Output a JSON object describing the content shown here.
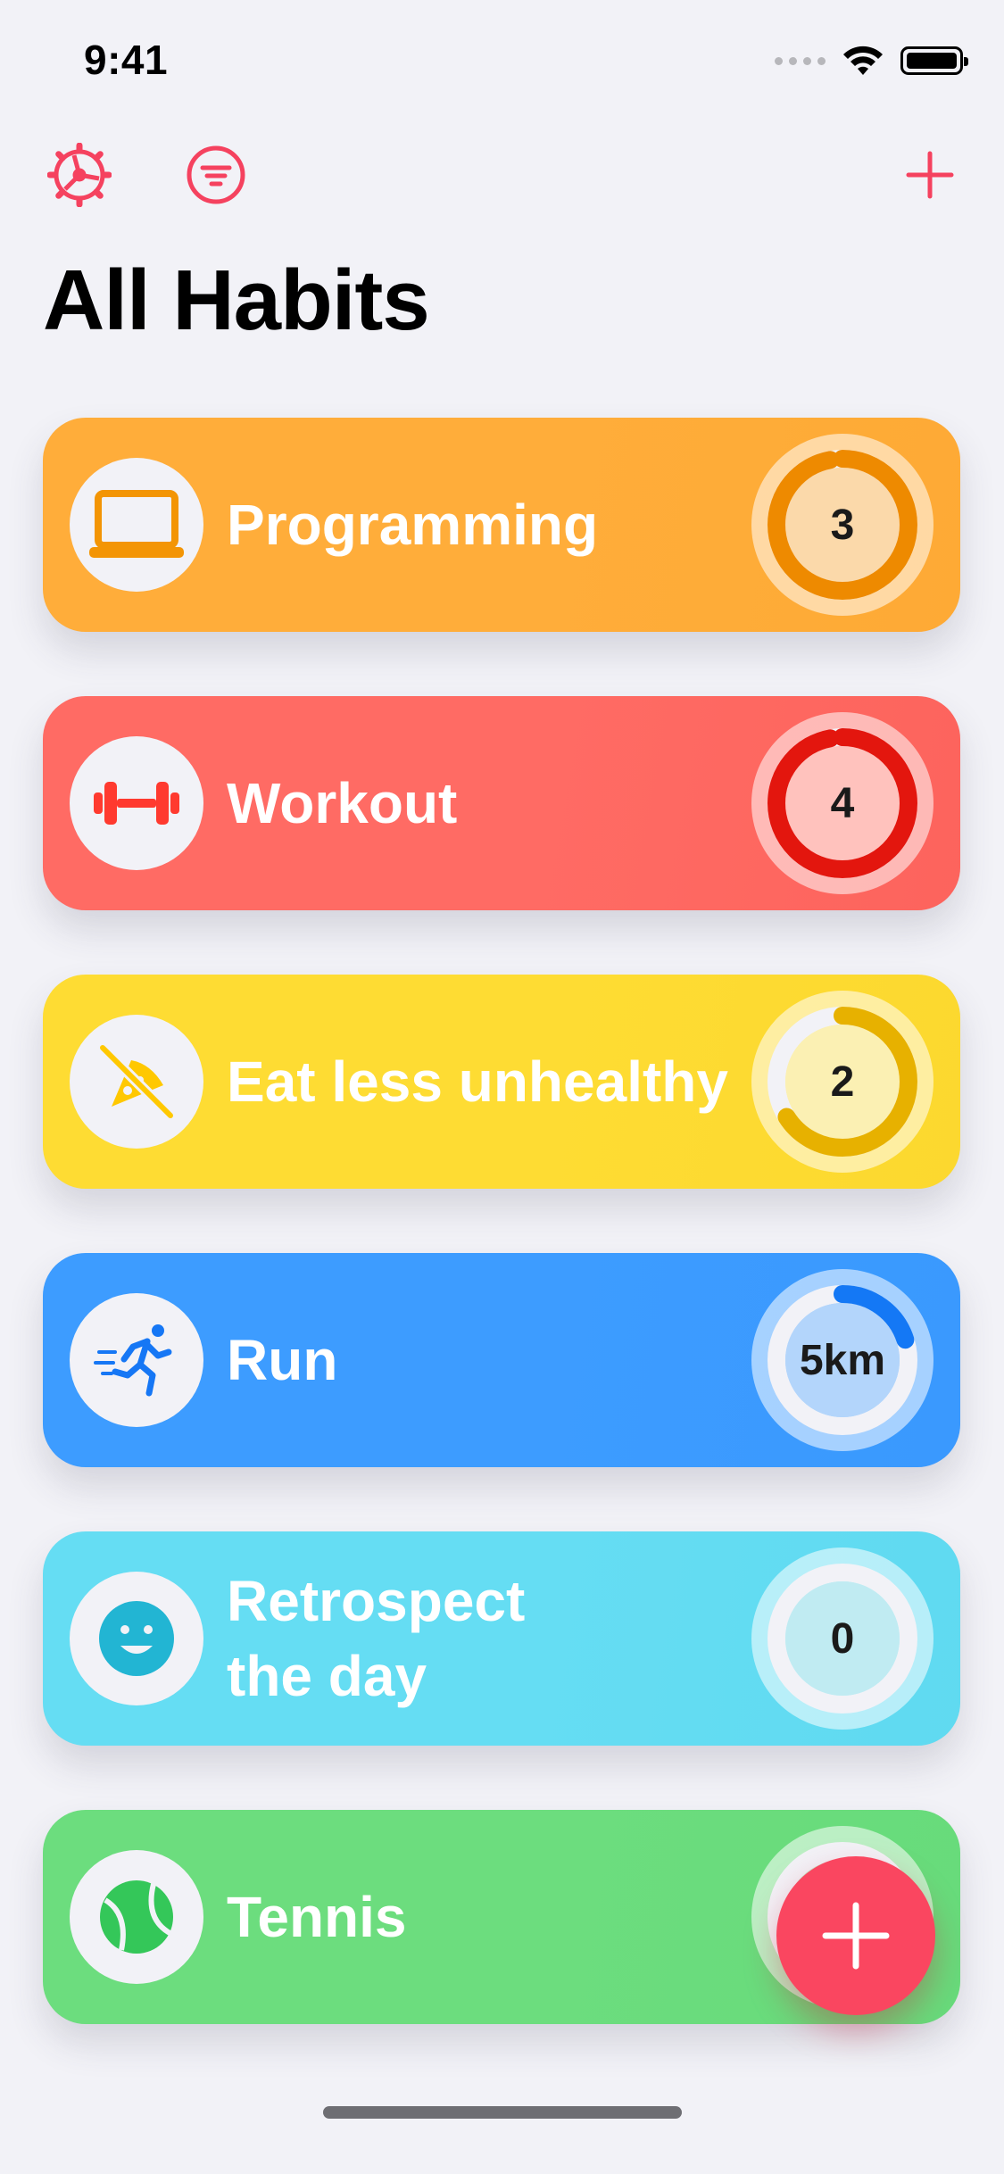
{
  "status_bar": {
    "time": "9:41"
  },
  "page": {
    "title": "All Habits"
  },
  "habits": [
    {
      "name": "Programming",
      "value": "3",
      "icon": "laptop-icon",
      "progress": 0.97,
      "color": "#ffad3a",
      "accent": "#ee8a00",
      "track": "#fbd9aa"
    },
    {
      "name": "Workout",
      "value": "4",
      "icon": "dumbbell-icon",
      "progress": 0.97,
      "color": "#ff6b64",
      "accent": "#e3160e",
      "track": "#ffc2bd"
    },
    {
      "name": "Eat less unhealthy",
      "value": "2",
      "icon": "no-pizza-icon",
      "progress": 0.66,
      "color": "#fedc33",
      "accent": "#e7b100",
      "track": "#fbf0b3"
    },
    {
      "name": "Run",
      "value": "5km",
      "icon": "runner-icon",
      "progress": 0.2,
      "color": "#3d9cff",
      "accent": "#1478f5",
      "track": "#b3d5fb"
    },
    {
      "name": "Retrospect\nthe day",
      "value": "0",
      "icon": "smiley-icon",
      "progress": 0,
      "color": "#65ddf3",
      "accent": "#23b7d6",
      "track": "#c0ebf2"
    },
    {
      "name": "Tennis",
      "value": "",
      "icon": "tennis-ball-icon",
      "progress": 0,
      "color": "#6cdd7e",
      "accent": "#34c759",
      "track": "#c6f0ce"
    }
  ],
  "colors": {
    "tint": "#f5425f",
    "background": "#f2f2f7"
  }
}
